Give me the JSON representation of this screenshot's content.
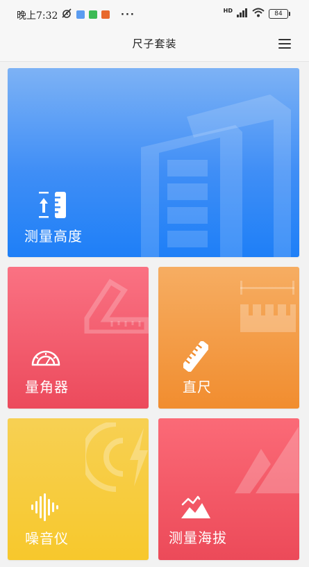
{
  "status_bar": {
    "time": "晚上7:32",
    "more": "···",
    "hd": "HD",
    "battery": "84"
  },
  "app_bar": {
    "title": "尺子套装",
    "menu_icon": "hamburger-menu-icon"
  },
  "cards": [
    {
      "id": "height",
      "label": "测量高度",
      "icon": "height-ruler-icon",
      "decoration": "building-icon"
    },
    {
      "id": "protractor",
      "label": "量角器",
      "icon": "gauge-icon",
      "decoration": "set-square-icon"
    },
    {
      "id": "ruler",
      "label": "直尺",
      "icon": "ruler-icon",
      "decoration": "ruler-measure-icon"
    },
    {
      "id": "noise",
      "label": "噪音仪",
      "icon": "sound-wave-icon",
      "decoration": "sound-lightning-icon"
    },
    {
      "id": "altitude",
      "label": "测量海拔",
      "icon": "mountain-icon",
      "decoration": "mountain-icon"
    }
  ],
  "colors": {
    "height_card": "#1e7ff7",
    "protractor_card": "#ec4a5c",
    "ruler_card": "#f18d2f",
    "noise_card": "#f7c82c",
    "altitude_card": "#ec4a59",
    "background": "#f2f2f2"
  }
}
